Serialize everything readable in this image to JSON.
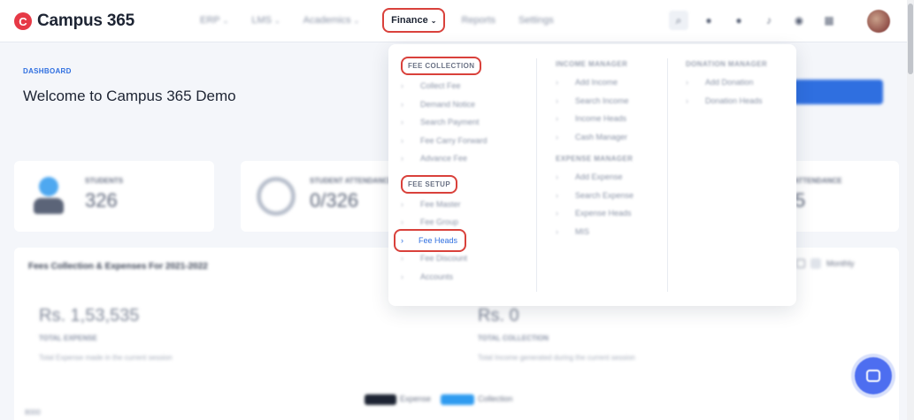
{
  "app": {
    "logo_mark": "C",
    "name": "Campus 365"
  },
  "nav": {
    "items": [
      {
        "label": "ERP",
        "caret": "⌄"
      },
      {
        "label": "LMS",
        "caret": "⌄"
      },
      {
        "label": "Academics",
        "caret": "⌄"
      }
    ],
    "active": {
      "label": "Finance",
      "caret": "⌄"
    },
    "after": [
      {
        "label": "Reports"
      },
      {
        "label": "Settings"
      }
    ]
  },
  "dashboard": {
    "breadcrumb": "DASHBOARD",
    "welcome": "Welcome to Campus 365 Demo",
    "stats": [
      {
        "caption": "STUDENTS",
        "value": "326"
      },
      {
        "caption": "STUDENT ATTENDANCE",
        "value": "0/326"
      },
      {
        "caption": "STAFF ATTENDANCE",
        "value": "5"
      }
    ],
    "finance_card": {
      "title": "Fees Collection & Expenses For 2021-2022",
      "expense_amount": "Rs. 1,53,535",
      "expense_caption": "TOTAL EXPENSE",
      "expense_sub": "Total Expense made in the current session",
      "collection_amount": "Rs. 0",
      "collection_caption": "TOTAL COLLECTION",
      "collection_sub": "Total Income generated during the current session",
      "legend_expense": "Expense",
      "legend_collection": "Collection",
      "toggle_label": "Monthly",
      "footer_value": "8000"
    }
  },
  "menu": {
    "col1": {
      "fee_collection": {
        "heading": "FEE COLLECTION",
        "items": [
          "Collect Fee",
          "Demand Notice",
          "Search Payment",
          "Fee Carry Forward",
          "Advance Fee"
        ]
      },
      "fee_setup": {
        "heading": "FEE SETUP",
        "items_before": [
          "Fee Master",
          "Fee Group"
        ],
        "highlighted": "Fee Heads",
        "items_after": [
          "Fee Discount",
          "Accounts"
        ]
      }
    },
    "col2": {
      "income": {
        "heading": "INCOME MANAGER",
        "items": [
          "Add Income",
          "Search Income",
          "Income Heads",
          "Cash Manager"
        ]
      },
      "expense": {
        "heading": "EXPENSE MANAGER",
        "items": [
          "Add Expense",
          "Search Expense",
          "Expense Heads",
          "MIS"
        ]
      }
    },
    "col3": {
      "donation": {
        "heading": "DONATION MANAGER",
        "items": [
          "Add Donation",
          "Donation Heads"
        ]
      }
    },
    "chevron": "›"
  },
  "colors": {
    "accent": "#2f6fe0",
    "highlight": "#d9413b",
    "brand": "#e63946"
  },
  "icons": [
    "search-icon",
    "globe-icon",
    "notification-icon",
    "settings-icon",
    "apps-icon",
    "avatar"
  ]
}
